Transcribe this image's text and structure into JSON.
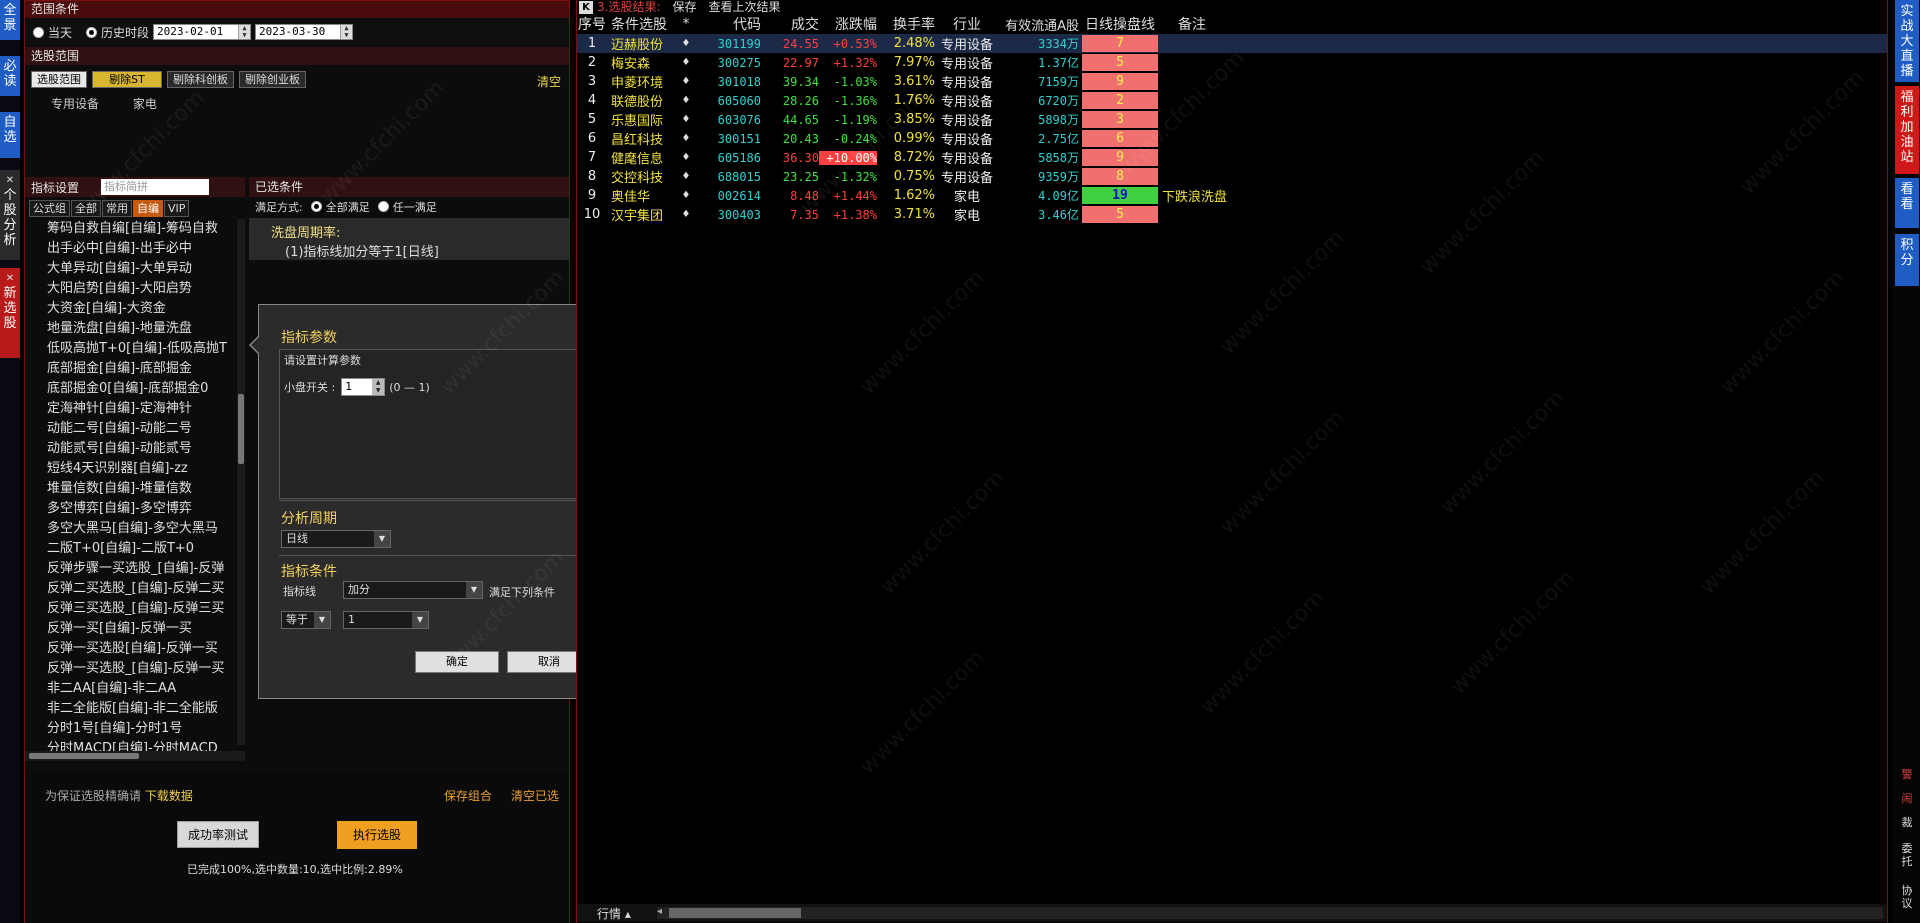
{
  "left_strip": {
    "tabs": [
      {
        "label": "全景",
        "closable": false
      },
      {
        "label": "必读",
        "closable": false
      },
      {
        "label": "自选",
        "closable": false
      },
      {
        "label": "个股分析",
        "closable": true
      },
      {
        "label": "新选股",
        "closable": true
      }
    ]
  },
  "left_panel": {
    "range_title": "范围条件",
    "today_label": "当天",
    "history_label": "历史时段",
    "date_from": "2023-02-01",
    "date_to": "2023-03-30",
    "scope_title": "选股范围",
    "scope_buttons": [
      "选股范围",
      "剔除ST",
      "剔除科创板",
      "剔除创业板"
    ],
    "clear_label": "清空",
    "scope_tags": [
      "专用设备",
      "家电"
    ],
    "indicator_title": "指标设置",
    "indicator_search_placeholder": "指标简拼",
    "indicator_tabs": [
      "公式组",
      "全部",
      "常用",
      "自编",
      "VIP"
    ],
    "indicator_list": [
      "筹码自救自编[自编]-筹码自救",
      "出手必中[自编]-出手必中",
      "大单异动[自编]-大单异动",
      "大阳启势[自编]-大阳启势",
      "大资金[自编]-大资金",
      "地量洗盘[自编]-地量洗盘",
      "低吸高抛T+0[自编]-低吸高抛T",
      "底部掘金[自编]-底部掘金",
      "底部掘金0[自编]-底部掘金0",
      "定海神针[自编]-定海神针",
      "动能二号[自编]-动能二号",
      "动能贰号[自编]-动能贰号",
      "短线4天识别器[自编]-zz",
      "堆量信数[自编]-堆量信数",
      "多空博弈[自编]-多空博弈",
      "多空大黑马[自编]-多空大黑马",
      "二版T+0[自编]-二版T+0",
      "反弹步骤一买选股_[自编]-反弹",
      "反弹二买选股_[自编]-反弹二买",
      "反弹三买选股_[自编]-反弹三买",
      "反弹一买[自编]-反弹一买",
      "反弹一买选股[自编]-反弹一买",
      "反弹一买选股_[自编]-反弹一买",
      "非二AA[自编]-非二AA",
      "非二全能版[自编]-非二全能版",
      "分时1号[自编]-分时1号",
      "分时MACD[自编]-分时MACD"
    ],
    "selected_title": "已选条件",
    "satisfy_label": "满足方式:",
    "satisfy_all": "全部满足",
    "satisfy_any": "任一满足",
    "condition_name": "洗盘周期率:",
    "condition_detail": "(1)指标线加分等于1[日线]",
    "note_text": "为保证选股精确请",
    "download_label": "下载数据",
    "save_combo_label": "保存组合",
    "clear_selected_label": "清空已选",
    "test_button": "成功率测试",
    "exec_button": "执行选股",
    "progress_text": "已完成100%,选中数量:10,选中比例:2.89%"
  },
  "dialog": {
    "param_title": "指标参数",
    "param_subtitle": "请设置计算参数",
    "param_name": "小盘开关 :",
    "param_value": "1",
    "param_range": "(0 — 1)",
    "period_title": "分析周期",
    "period_value": "日线",
    "cond_title": "指标条件",
    "line_label": "指标线",
    "line_value": "加分",
    "satisfy_text": "满足下列条件",
    "op_value": "等于",
    "cmp_value": "1",
    "ok_button": "确定",
    "cancel_button": "取消"
  },
  "right_panel": {
    "title": "3.选股结果:",
    "save_link": "保存",
    "last_link": "查看上次结果",
    "columns": [
      "序号",
      "条件选股",
      "*",
      "代码",
      "成交",
      "涨跌幅",
      "换手率",
      "行业",
      "有效流通A股",
      "日线操盘线",
      "备注"
    ],
    "rows": [
      {
        "no": "1",
        "name": "迈赫股份",
        "star": "♦",
        "code": "301199",
        "price": "24.55",
        "chg": "+0.53%",
        "turn": "2.48%",
        "industry": "专用设备",
        "float": "3334万",
        "wash": "7",
        "note": ""
      },
      {
        "no": "2",
        "name": "梅安森",
        "star": "♦",
        "code": "300275",
        "price": "22.97",
        "chg": "+1.32%",
        "turn": "7.97%",
        "industry": "专用设备",
        "float": "1.37亿",
        "wash": "5",
        "note": ""
      },
      {
        "no": "3",
        "name": "申菱环境",
        "star": "♦",
        "code": "301018",
        "price": "39.34",
        "chg": "-1.03%",
        "turn": "3.61%",
        "industry": "专用设备",
        "float": "7159万",
        "wash": "9",
        "note": ""
      },
      {
        "no": "4",
        "name": "联德股份",
        "star": "♦",
        "code": "605060",
        "price": "28.26",
        "chg": "-1.36%",
        "turn": "1.76%",
        "industry": "专用设备",
        "float": "6720万",
        "wash": "2",
        "note": ""
      },
      {
        "no": "5",
        "name": "乐惠国际",
        "star": "♦",
        "code": "603076",
        "price": "44.65",
        "chg": "-1.19%",
        "turn": "3.85%",
        "industry": "专用设备",
        "float": "5898万",
        "wash": "3",
        "note": ""
      },
      {
        "no": "6",
        "name": "昌红科技",
        "star": "♦",
        "code": "300151",
        "price": "20.43",
        "chg": "-0.24%",
        "turn": "0.99%",
        "industry": "专用设备",
        "float": "2.75亿",
        "wash": "6",
        "note": ""
      },
      {
        "no": "7",
        "name": "健麾信息",
        "star": "♦",
        "code": "605186",
        "price": "36.30",
        "chg": "+10.00%",
        "turn": "8.72%",
        "industry": "专用设备",
        "float": "5858万",
        "wash": "9",
        "note": ""
      },
      {
        "no": "8",
        "name": "交控科技",
        "star": "♦",
        "code": "688015",
        "price": "23.25",
        "chg": "-1.32%",
        "turn": "0.75%",
        "industry": "专用设备",
        "float": "9359万",
        "wash": "8",
        "note": ""
      },
      {
        "no": "9",
        "name": "奥佳华",
        "star": "♦",
        "code": "002614",
        "price": "8.48",
        "chg": "+1.44%",
        "turn": "1.62%",
        "industry": "家电",
        "float": "4.09亿",
        "wash": "19",
        "note": "下跌浪洗盘"
      },
      {
        "no": "10",
        "name": "汉宇集团",
        "star": "♦",
        "code": "300403",
        "price": "7.35",
        "chg": "+1.38%",
        "turn": "3.71%",
        "industry": "家电",
        "float": "3.46亿",
        "wash": "5",
        "note": ""
      }
    ],
    "bottom_tab": "行情 ▴"
  },
  "right_strip": {
    "tabs": [
      "实战大直播",
      "福利加油站",
      "看看",
      "积分"
    ],
    "icons": [
      "警",
      "闹",
      "裁",
      "委托",
      "协议"
    ]
  },
  "watermark": "www.cfchi.com",
  "colors": {
    "accent_red": "#7a1010",
    "price_up": "#ff4040",
    "price_down": "#40e040",
    "highlight_yellow": "#f0e040"
  }
}
